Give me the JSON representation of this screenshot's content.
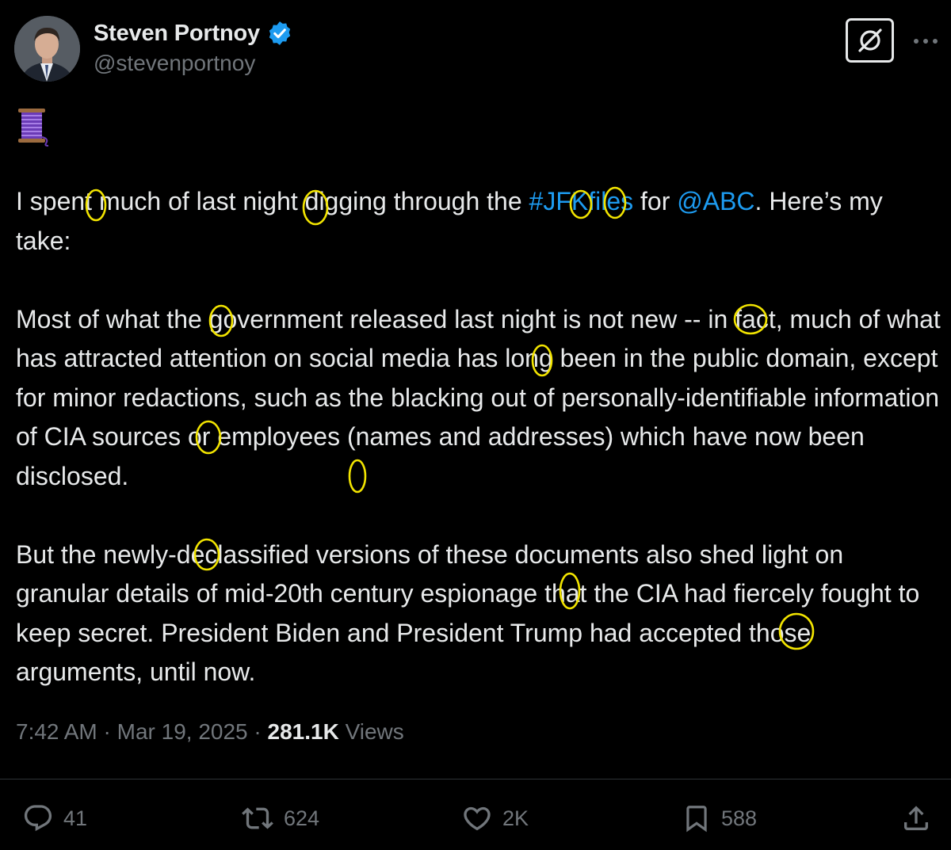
{
  "author": {
    "display_name": "Steven Portnoy",
    "handle": "@stevenportnoy"
  },
  "icons": {
    "verified": "verified-badge-icon",
    "grok": "grok-icon",
    "more": "more-icon",
    "thread": "thread-spool-emoji",
    "reply": "reply-icon",
    "retweet": "retweet-icon",
    "like": "like-icon",
    "bookmark": "bookmark-icon",
    "share": "share-icon"
  },
  "tweet": {
    "p1": {
      "before": "I spent much of last night digging through the ",
      "hashtag": "#JFKfiles",
      "middle": " for ",
      "mention": "@ABC",
      "after": ". Here’s my take:"
    },
    "p2": "Most of what the government released last night is not new -- in fact, much of what has attracted attention on social media has long been in the public domain, except for minor redactions, such as the blacking out of personally-identifiable information of CIA sources or employees (names and addresses) which have now been disclosed.",
    "p3": "But the newly-declassified versions of these documents also shed light on granular details of mid-20th century espionage that the CIA had fiercely fought to keep secret. President Biden and President Trump had accepted those arguments, until now."
  },
  "meta": {
    "time": "7:42 AM",
    "sep1": " · ",
    "date": "Mar 19, 2025",
    "sep2": " · ",
    "views_count": "281.1K",
    "views_label": " Views"
  },
  "actions": {
    "replies": "41",
    "retweets": "624",
    "likes": "2K",
    "bookmarks": "588"
  },
  "colors": {
    "background": "#000000",
    "text": "#e7e9ea",
    "secondary": "#71767b",
    "link": "#1d9bf0",
    "annotation": "#f2e400"
  }
}
